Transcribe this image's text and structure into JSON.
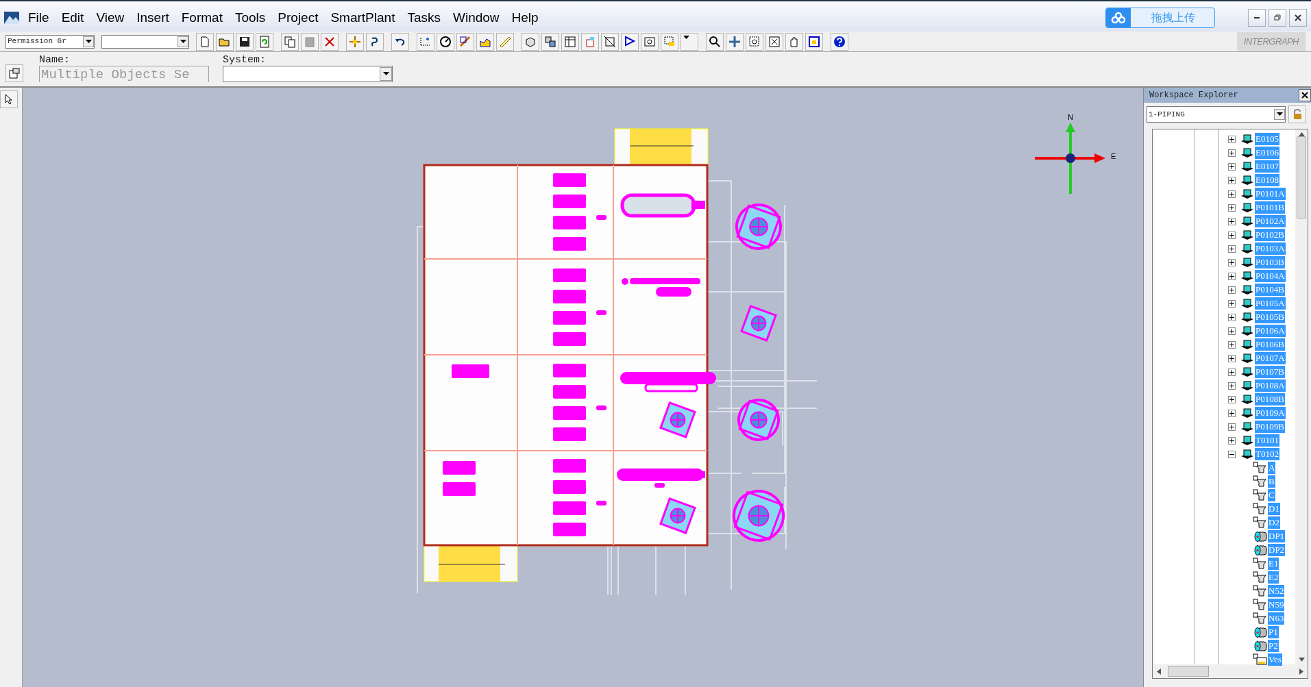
{
  "menu": [
    "File",
    "Edit",
    "View",
    "Insert",
    "Format",
    "Tools",
    "Project",
    "SmartPlant",
    "Tasks",
    "Window",
    "Help"
  ],
  "upload_button": {
    "label": "拖拽上传"
  },
  "toolbar": {
    "permission_group": "Permission Gr"
  },
  "logo": {
    "text": "INTERGRAPH"
  },
  "properties": {
    "name_label": "Name:",
    "name_value": "Multiple Objects Se",
    "system_label": "System:"
  },
  "compass": {
    "north": "N",
    "east": "E"
  },
  "workspace_explorer": {
    "title": "Workspace Explorer",
    "filter": "1-PIPING",
    "tree": [
      {
        "label": "E0105",
        "kind": "equipment",
        "expanded": false,
        "selected": true
      },
      {
        "label": "E0106",
        "kind": "equipment",
        "expanded": false,
        "selected": true
      },
      {
        "label": "E0107",
        "kind": "equipment",
        "expanded": false,
        "selected": true
      },
      {
        "label": "E0108",
        "kind": "equipment",
        "expanded": false,
        "selected": true
      },
      {
        "label": "P0101A",
        "kind": "equipment",
        "expanded": false,
        "selected": true
      },
      {
        "label": "P0101B",
        "kind": "equipment",
        "expanded": false,
        "selected": true
      },
      {
        "label": "P0102A",
        "kind": "equipment",
        "expanded": false,
        "selected": true
      },
      {
        "label": "P0102B",
        "kind": "equipment",
        "expanded": false,
        "selected": true
      },
      {
        "label": "P0103A",
        "kind": "equipment",
        "expanded": false,
        "selected": true
      },
      {
        "label": "P0103B",
        "kind": "equipment",
        "expanded": false,
        "selected": true
      },
      {
        "label": "P0104A",
        "kind": "equipment",
        "expanded": false,
        "selected": true
      },
      {
        "label": "P0104B",
        "kind": "equipment",
        "expanded": false,
        "selected": true
      },
      {
        "label": "P0105A",
        "kind": "equipment",
        "expanded": false,
        "selected": true
      },
      {
        "label": "P0105B",
        "kind": "equipment",
        "expanded": false,
        "selected": true
      },
      {
        "label": "P0106A",
        "kind": "equipment",
        "expanded": false,
        "selected": true
      },
      {
        "label": "P0106B",
        "kind": "equipment",
        "expanded": false,
        "selected": true
      },
      {
        "label": "P0107A",
        "kind": "equipment",
        "expanded": false,
        "selected": true
      },
      {
        "label": "P0107B",
        "kind": "equipment",
        "expanded": false,
        "selected": true
      },
      {
        "label": "P0108A",
        "kind": "equipment",
        "expanded": false,
        "selected": true
      },
      {
        "label": "P0108B",
        "kind": "equipment",
        "expanded": false,
        "selected": true
      },
      {
        "label": "P0109A",
        "kind": "equipment",
        "expanded": false,
        "selected": true
      },
      {
        "label": "P0109B",
        "kind": "equipment",
        "expanded": false,
        "selected": true
      },
      {
        "label": "T0101",
        "kind": "equipment",
        "expanded": false,
        "selected": true
      },
      {
        "label": "T0102",
        "kind": "equipment",
        "expanded": true,
        "selected": true,
        "children": [
          {
            "label": "A",
            "kind": "nozzle",
            "selected": true
          },
          {
            "label": "B",
            "kind": "nozzle",
            "selected": true
          },
          {
            "label": "C",
            "kind": "nozzle",
            "selected": true
          },
          {
            "label": "D1",
            "kind": "nozzle",
            "selected": true
          },
          {
            "label": "D2",
            "kind": "nozzle",
            "selected": true
          },
          {
            "label": "DP1",
            "kind": "port",
            "selected": true
          },
          {
            "label": "DP2",
            "kind": "port",
            "selected": true
          },
          {
            "label": "E1",
            "kind": "nozzle",
            "selected": true
          },
          {
            "label": "E2",
            "kind": "nozzle",
            "selected": true
          },
          {
            "label": "N52",
            "kind": "nozzle",
            "selected": true
          },
          {
            "label": "N59",
            "kind": "nozzle",
            "selected": true
          },
          {
            "label": "N63",
            "kind": "nozzle",
            "selected": true
          },
          {
            "label": "P1",
            "kind": "port",
            "selected": true
          },
          {
            "label": "P2",
            "kind": "port",
            "selected": true
          },
          {
            "label": "Ves",
            "kind": "vessel",
            "selected": true
          }
        ]
      }
    ]
  }
}
